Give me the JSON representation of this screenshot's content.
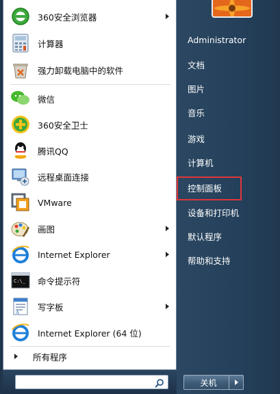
{
  "programs": [
    {
      "label": "360安全浏览器",
      "icon": "360-browser-icon",
      "submenu": true
    },
    {
      "label": "计算器",
      "icon": "calculator-icon",
      "submenu": false
    },
    {
      "label": "强力卸载电脑中的软件",
      "icon": "uninstaller-icon",
      "submenu": false
    },
    {
      "label": "微信",
      "icon": "wechat-icon",
      "submenu": false
    },
    {
      "label": "360安全卫士",
      "icon": "360-safe-icon",
      "submenu": false
    },
    {
      "label": "腾讯QQ",
      "icon": "qq-icon",
      "submenu": false
    },
    {
      "label": "远程桌面连接",
      "icon": "remote-desktop-icon",
      "submenu": false
    },
    {
      "label": "VMware",
      "icon": "vmware-icon",
      "submenu": false
    },
    {
      "label": "画图",
      "icon": "paint-icon",
      "submenu": true
    },
    {
      "label": "Internet Explorer",
      "icon": "ie-icon",
      "submenu": true
    },
    {
      "label": "命令提示符",
      "icon": "cmd-icon",
      "submenu": false
    },
    {
      "label": "写字板",
      "icon": "wordpad-icon",
      "submenu": true
    },
    {
      "label": "Internet Explorer (64 位)",
      "icon": "ie-icon",
      "submenu": false
    }
  ],
  "all_programs": "所有程序",
  "search": {
    "value": "",
    "placeholder": ""
  },
  "right_items": [
    {
      "label": "Administrator"
    },
    {
      "label": "文档"
    },
    {
      "label": "图片"
    },
    {
      "label": "音乐"
    },
    {
      "label": "游戏"
    },
    {
      "label": "计算机"
    },
    {
      "label": "控制面板"
    },
    {
      "label": "设备和打印机"
    },
    {
      "label": "默认程序"
    },
    {
      "label": "帮助和支持"
    }
  ],
  "shutdown_label": "关机",
  "colors": {
    "highlight": "#e0363a",
    "right_pane": "#24405b"
  }
}
